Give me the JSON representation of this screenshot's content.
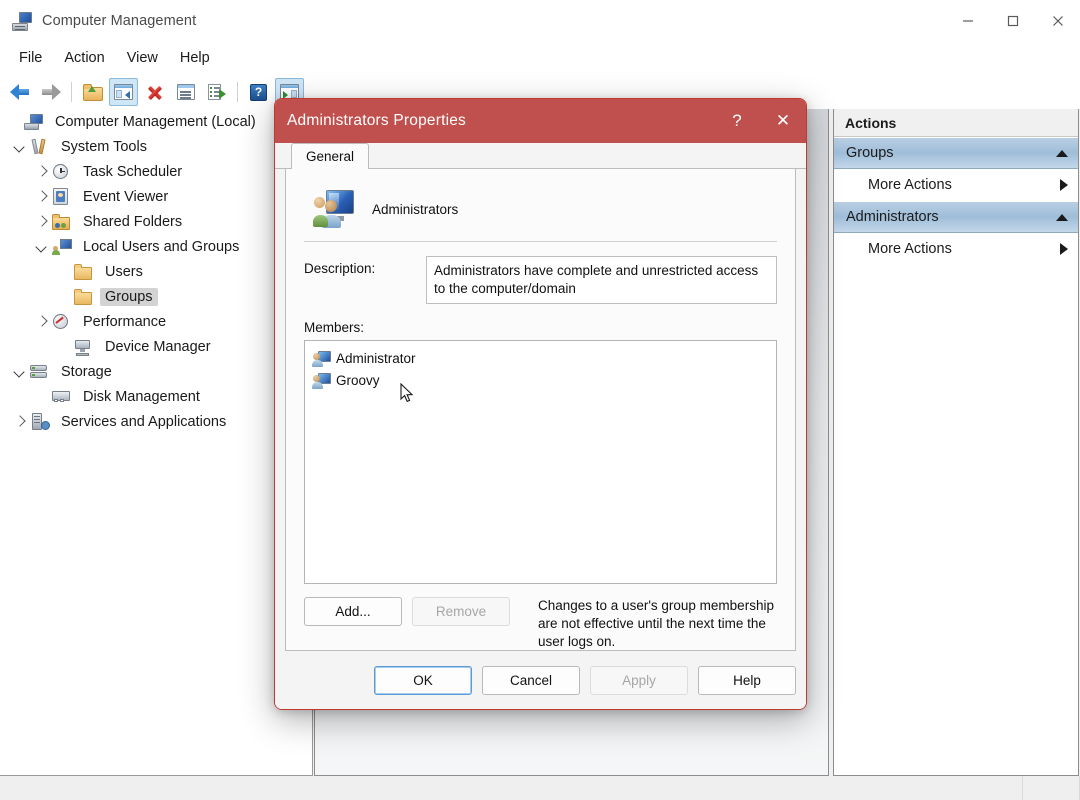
{
  "window": {
    "title": "Computer Management",
    "icon": "computer-management-icon",
    "controls": {
      "minimize": "minimize-icon",
      "maximize": "maximize-icon",
      "close": "close-icon"
    }
  },
  "menubar": {
    "items": [
      "File",
      "Action",
      "View",
      "Help"
    ]
  },
  "toolbar": {
    "buttons": [
      {
        "name": "back-button",
        "icon": "back-arrow-icon",
        "active": false
      },
      {
        "name": "forward-button",
        "icon": "forward-arrow-icon",
        "active": false
      },
      {
        "name": "up-one-level-button",
        "icon": "folder-up-icon",
        "active": false
      },
      {
        "name": "show-hide-console-tree-button",
        "icon": "console-tree-icon",
        "active": true
      },
      {
        "name": "delete-button",
        "icon": "delete-x-icon",
        "active": false
      },
      {
        "name": "properties-button",
        "icon": "properties-icon",
        "active": false
      },
      {
        "name": "export-list-button",
        "icon": "export-list-icon",
        "active": false
      },
      {
        "name": "help-button",
        "icon": "help-question-icon",
        "active": false
      },
      {
        "name": "show-hide-action-pane-button",
        "icon": "action-pane-icon",
        "active": true
      }
    ]
  },
  "tree": {
    "nodes": [
      {
        "label": "Computer Management (Local)",
        "indent": 0,
        "twisty": "none",
        "icon": "computer-icon",
        "selected": false
      },
      {
        "label": "System Tools",
        "indent": 1,
        "twisty": "open",
        "icon": "tools-icon",
        "selected": false
      },
      {
        "label": "Task Scheduler",
        "indent": 2,
        "twisty": "closed",
        "icon": "clock-icon",
        "selected": false
      },
      {
        "label": "Event Viewer",
        "indent": 2,
        "twisty": "closed",
        "icon": "event-viewer-icon",
        "selected": false
      },
      {
        "label": "Shared Folders",
        "indent": 2,
        "twisty": "closed",
        "icon": "shared-folders-icon",
        "selected": false
      },
      {
        "label": "Local Users and Groups",
        "indent": 2,
        "twisty": "open",
        "icon": "local-users-groups-icon",
        "selected": false
      },
      {
        "label": "Users",
        "indent": 3,
        "twisty": "none",
        "icon": "folder-icon",
        "selected": false
      },
      {
        "label": "Groups",
        "indent": 3,
        "twisty": "none",
        "icon": "folder-icon",
        "selected": true
      },
      {
        "label": "Performance",
        "indent": 2,
        "twisty": "closed",
        "icon": "performance-icon",
        "selected": false
      },
      {
        "label": "Device Manager",
        "indent": 2,
        "twisty": "none",
        "icon": "device-manager-icon",
        "selected": false
      },
      {
        "label": "Storage",
        "indent": 1,
        "twisty": "open",
        "icon": "storage-icon",
        "selected": false
      },
      {
        "label": "Disk Management",
        "indent": 2,
        "twisty": "none",
        "icon": "disk-management-icon",
        "selected": false
      },
      {
        "label": "Services and Applications",
        "indent": 1,
        "twisty": "closed",
        "icon": "services-icon",
        "selected": false
      }
    ]
  },
  "actions_pane": {
    "title": "Actions",
    "groups": [
      {
        "header": "Groups",
        "items": [
          "More Actions"
        ]
      },
      {
        "header": "Administrators",
        "items": [
          "More Actions"
        ]
      }
    ]
  },
  "dialog": {
    "title": "Administrators Properties",
    "help_button": "?",
    "close_button": "✕",
    "titlebar_color": "#c0504d",
    "tabs": [
      {
        "label": "General",
        "active": true
      }
    ],
    "group_name": "Administrators",
    "group_icon": "group-users-icon",
    "description_label": "Description:",
    "description_value": "Administrators have complete and unrestricted access to the computer/domain",
    "members_label": "Members:",
    "members": [
      {
        "name": "Administrator",
        "icon": "user-icon"
      },
      {
        "name": "Groovy",
        "icon": "user-icon"
      }
    ],
    "add_button": {
      "label": "Add...",
      "disabled": false
    },
    "remove_button": {
      "label": "Remove",
      "disabled": true
    },
    "hint_text": "Changes to a user's group membership are not effective until the next time the user logs on.",
    "footer_buttons": [
      {
        "label": "OK",
        "disabled": false,
        "default": true
      },
      {
        "label": "Cancel",
        "disabled": false,
        "default": false
      },
      {
        "label": "Apply",
        "disabled": true,
        "default": false
      },
      {
        "label": "Help",
        "disabled": false,
        "default": false
      }
    ]
  }
}
